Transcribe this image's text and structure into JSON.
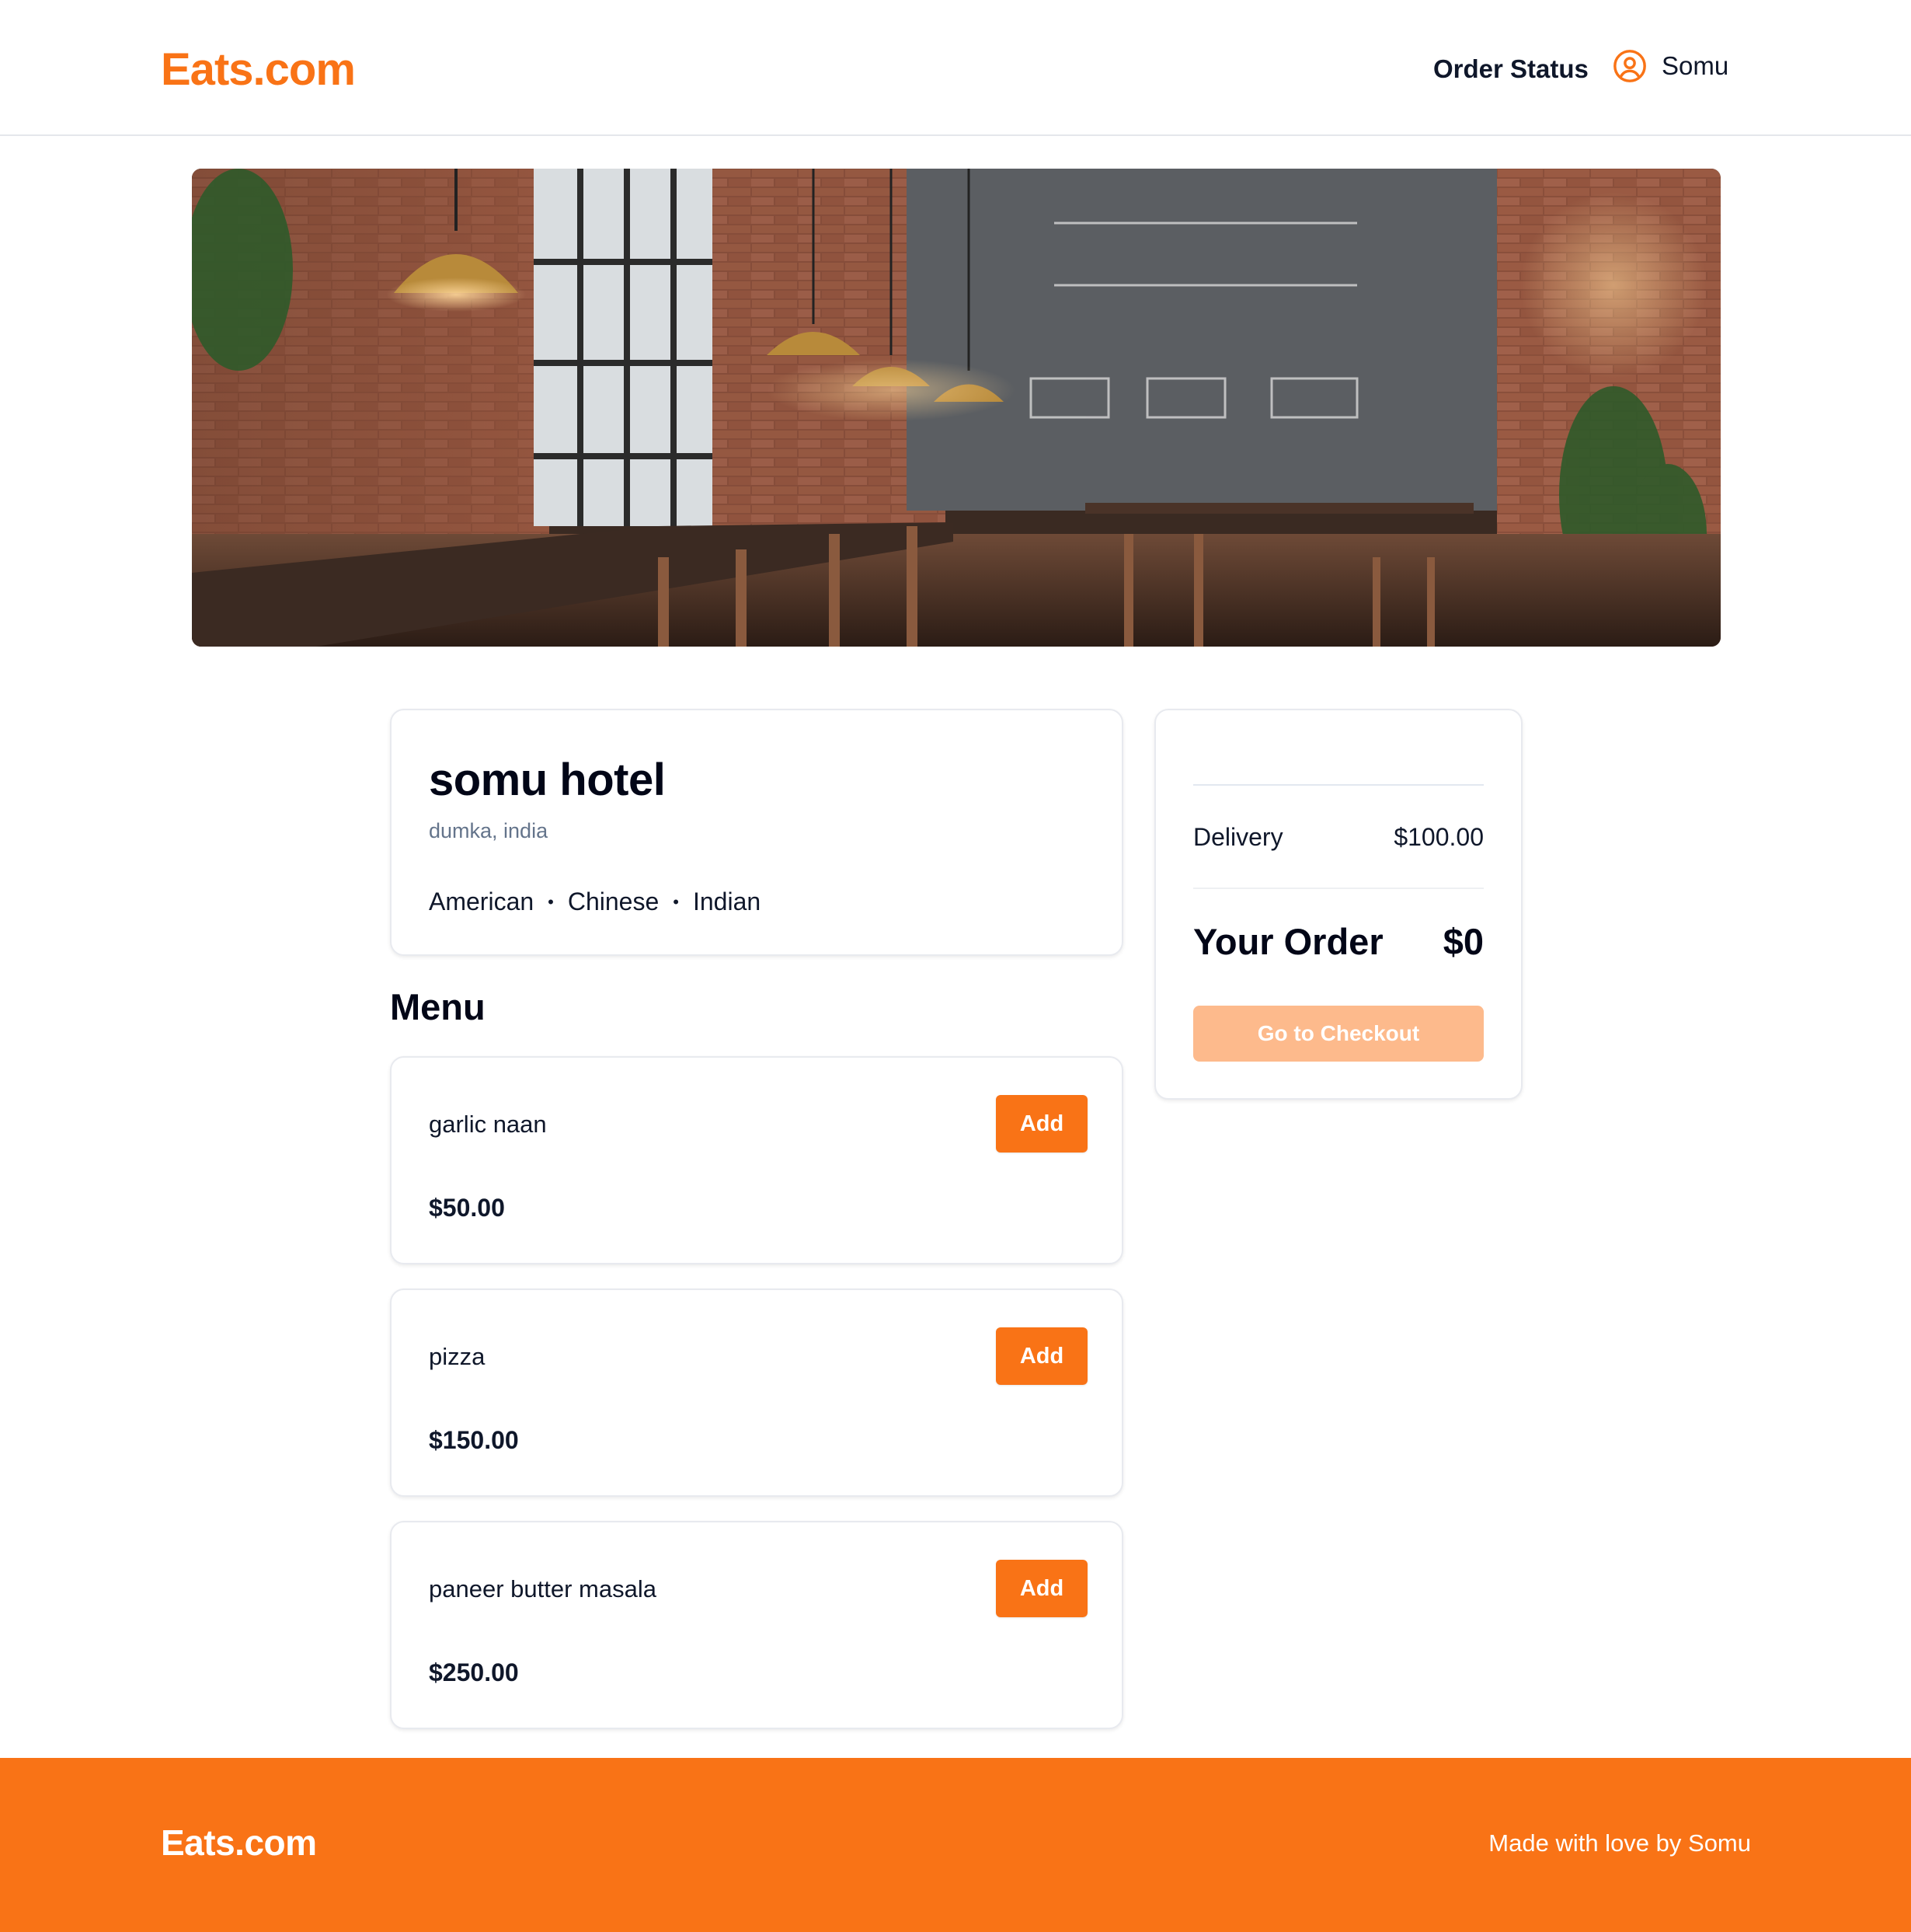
{
  "header": {
    "logo": "Eats.com",
    "order_status": "Order Status",
    "user_name": "Somu"
  },
  "hero": {
    "icon": "restaurant-hero-image"
  },
  "restaurant": {
    "name": "somu hotel",
    "location": "dumka, india",
    "cuisines": [
      "American",
      "Chinese",
      "Indian"
    ]
  },
  "menu": {
    "title": "Menu",
    "add_label": "Add",
    "items": [
      {
        "name": "garlic naan",
        "price": "$50.00"
      },
      {
        "name": "pizza",
        "price": "$150.00"
      },
      {
        "name": "paneer butter masala",
        "price": "$250.00"
      }
    ]
  },
  "order": {
    "delivery_label": "Delivery",
    "delivery_value": "$100.00",
    "your_order_label": "Your Order",
    "total": "$0",
    "checkout_label": "Go to Checkout"
  },
  "footer": {
    "logo": "Eats.com",
    "credit": "Made with love by Somu"
  },
  "colors": {
    "brand": "#f97316",
    "checkout_disabled": "#fdba8c"
  }
}
